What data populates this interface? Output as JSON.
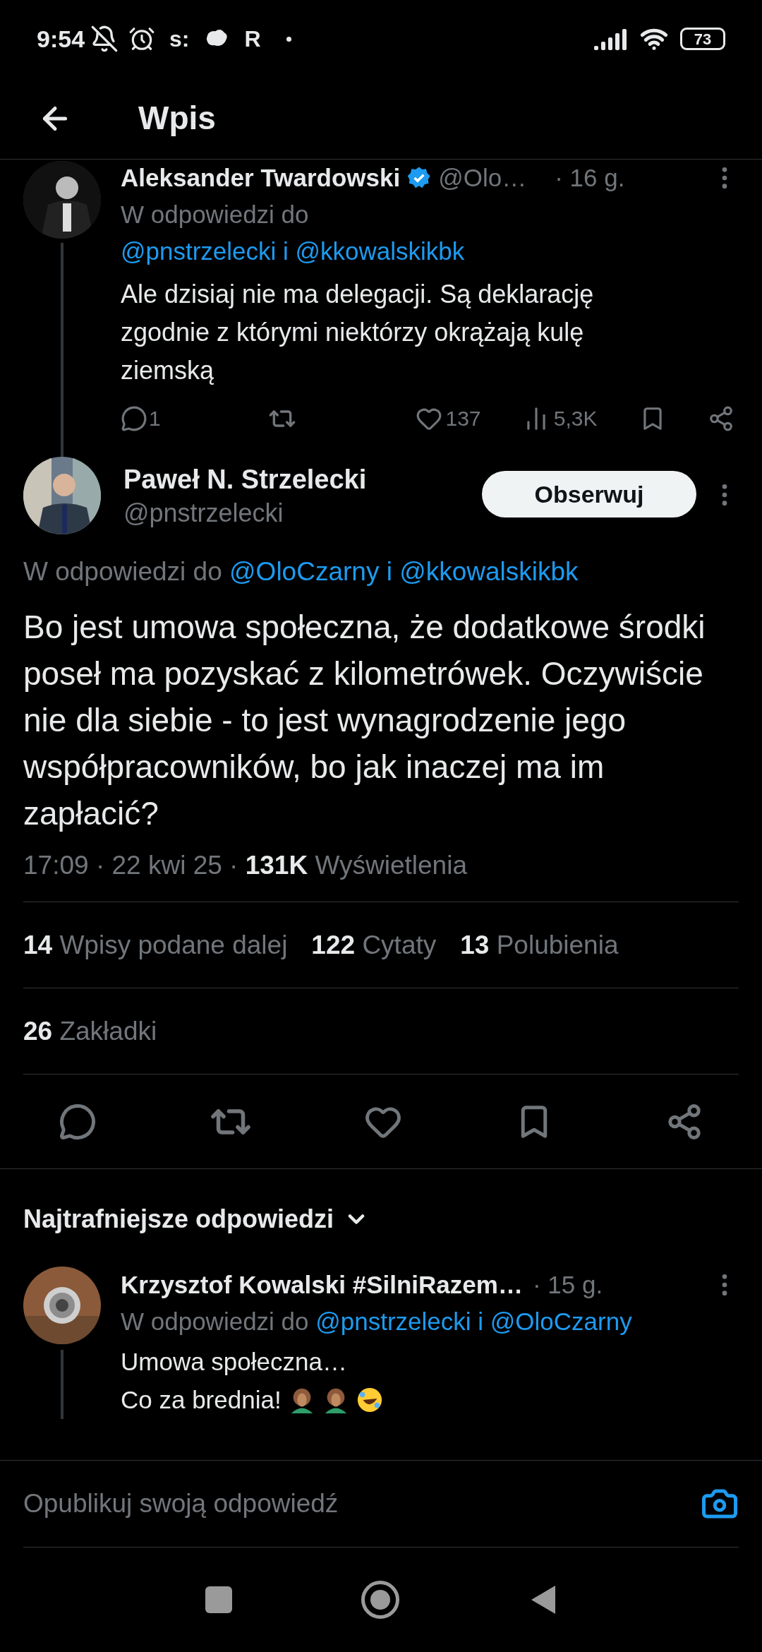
{
  "status_bar": {
    "time": "9:54",
    "notification_letters": [
      "s:",
      "R"
    ],
    "battery": "73"
  },
  "header": {
    "title": "Wpis"
  },
  "parent_tweet": {
    "name": "Aleksander Twardowski",
    "handle": "@Olo…",
    "time": "· 16 g.",
    "reply_prefix": "W odpowiedzi do",
    "reply_mentions": "@pnstrzelecki i @kkowalskikbk",
    "text": "Ale dzisiaj nie ma delegacji. Są deklarację zgodnie z którymi niektórzy okrążają kulę ziemską",
    "replies": "1",
    "likes": "137",
    "views": "5,3K"
  },
  "tweet": {
    "name": "Paweł N. Strzelecki",
    "handle": "@pnstrzelecki",
    "follow_button": "Obserwuj",
    "reply_prefix": "W odpowiedzi do",
    "reply_mentions": "@OloCzarny i @kkowalskikbk",
    "text": "Bo jest umowa społeczna, że dodatkowe środki poseł ma pozyskać z kilometrówek. Oczywiście nie dla siebie - to jest wynagrodzenie jego współpracowników, bo jak inaczej ma im zapłacić?",
    "time": "17:09",
    "separator": "·",
    "date": "22 kwi 25",
    "views_count": "131K",
    "views_label": "Wyświetlenia",
    "stat_rows": [
      [
        {
          "count": "14",
          "label": "Wpisy podane dalej"
        },
        {
          "count": "122",
          "label": "Cytaty"
        },
        {
          "count": "13",
          "label": "Polubienia"
        }
      ],
      [
        {
          "count": "26",
          "label": "Zakładki"
        }
      ]
    ]
  },
  "sort": {
    "label": "Najtrafniejsze odpowiedzi"
  },
  "reply": {
    "name": "Krzysztof Kowalski #SilniRazem…",
    "time": "· 15 g.",
    "reply_prefix": "W odpowiedzi do",
    "reply_mentions": "@pnstrzelecki i @OloCzarny",
    "lines": [
      "Umowa społeczna…",
      "Co za brednia!"
    ],
    "emojis": [
      {
        "kind": "facepalm"
      },
      {
        "kind": "facepalm"
      },
      {
        "kind": "laughing"
      }
    ]
  },
  "composer": {
    "placeholder": "Opublikuj swoją odpowiedź"
  }
}
